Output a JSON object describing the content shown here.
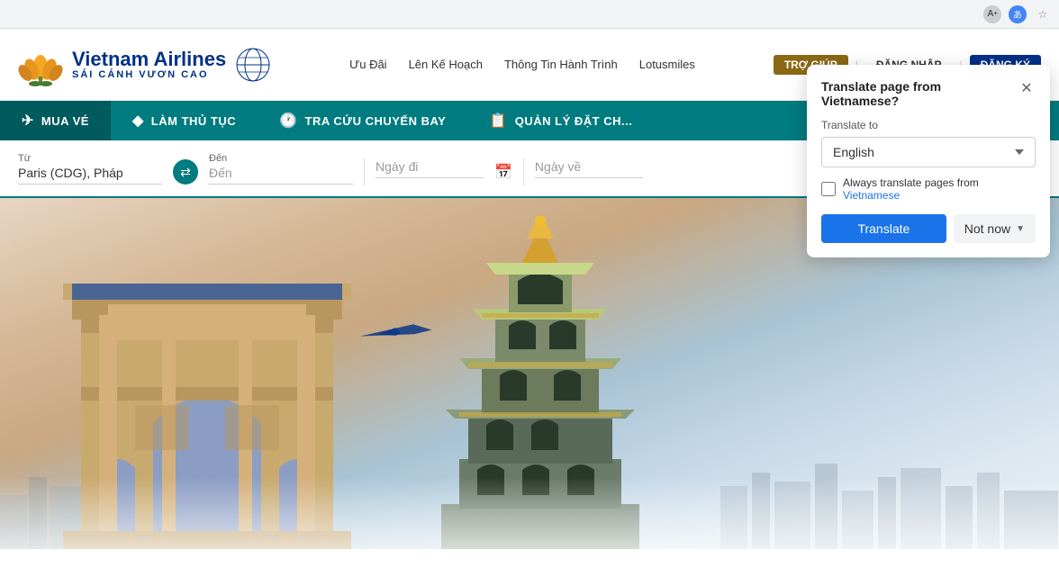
{
  "browser": {
    "icons": [
      "A_icon",
      "translate_icon",
      "star_icon"
    ]
  },
  "header": {
    "logo_name": "Vietnam Airlines",
    "logo_tagline": "SÁI CÁNH VƯƠN CAO",
    "nav_items": [
      "Ưu Đãi",
      "Lên Kế Hoạch",
      "Thông Tin Hành Trình",
      "Lotusmiles"
    ],
    "btn_support": "TRỢ GIÚP",
    "btn_login": "ĐĂNG NHẬP",
    "btn_register": "ĐĂNG KÝ"
  },
  "tabs": [
    {
      "id": "mua-ve",
      "label": "MUA VÉ",
      "active": true,
      "icon": "✈"
    },
    {
      "id": "lam-thu-tuc",
      "label": "LÀM THỦ TỤC",
      "active": false,
      "icon": "◆"
    },
    {
      "id": "tra-cuu",
      "label": "TRA CỨU CHUYẾN BAY",
      "active": false,
      "icon": "🕐"
    },
    {
      "id": "quan-ly",
      "label": "QUẢN LÝ ĐẶT CH...",
      "active": false,
      "icon": "📋"
    }
  ],
  "search_form": {
    "from_label": "Từ",
    "from_value": "Paris (CDG), Pháp",
    "to_label": "Đến",
    "depart_label": "Ngày đi",
    "return_label": "Ngày về"
  },
  "translate_popup": {
    "title": "Translate page from Vietnamese?",
    "translate_to_label": "Translate to",
    "language": "English",
    "always_translate_text": "Always translate pages from",
    "always_translate_lang": "Vietnamese",
    "translate_btn": "Translate",
    "not_now_btn": "Not now",
    "checkbox_checked": false
  }
}
